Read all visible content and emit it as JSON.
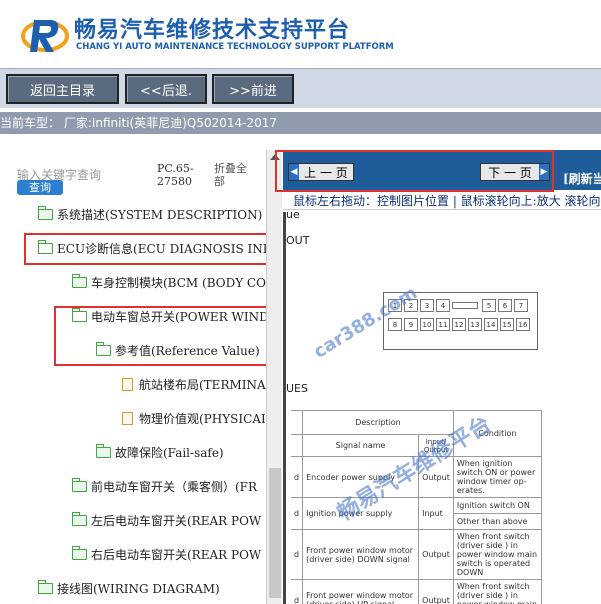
{
  "header": {
    "title_cn": "畅易汽车维修技术支持平台",
    "title_en": "CHANG YI AUTO MAINTENANCE TECHNOLOGY SUPPORT PLATFORM"
  },
  "nav": {
    "home": "返回主目录",
    "back": "<<后退.",
    "forward": ">>前进"
  },
  "current_car": "当前车型：  厂家:Infiniti(英菲尼迪)Q502014-2017",
  "left_panel": {
    "search_placeholder": "输入关键字查询",
    "search_button": "查询",
    "pc_code": "PC.65-27580",
    "collapse_all": "折叠全部",
    "tree": [
      {
        "label": "系统描述(SYSTEM DESCRIPTION)",
        "type": "folder"
      },
      {
        "label": "ECU诊断信息(ECU DIAGNOSIS INFO",
        "type": "folder-open"
      },
      {
        "label": "车身控制模块(BCM (BODY CO",
        "type": "folder"
      },
      {
        "label": "电动车窗总开关(POWER WIND",
        "type": "folder-open"
      },
      {
        "label": "参考值(Reference Value)",
        "type": "folder-open"
      },
      {
        "label": "航站楼布局(TERMINA",
        "type": "doc"
      },
      {
        "label": "物理价值观(PHYSICAI",
        "type": "doc"
      },
      {
        "label": "故障保险(Fail-safe)",
        "type": "folder"
      },
      {
        "label": "前电动车窗开关（乘客侧）(FR",
        "type": "folder"
      },
      {
        "label": "左后电动车窗开关(REAR POW",
        "type": "folder"
      },
      {
        "label": "右后电动车窗开关(REAR POW",
        "type": "folder"
      },
      {
        "label": "接线图(WIRING DIAGRAM)",
        "type": "folder"
      }
    ]
  },
  "viewer": {
    "prev_page": "上 一 页",
    "next_page": "下 一 页",
    "refresh": "[刷新当",
    "hint": "鼠标左右拖动：控制图片位置 | 鼠标滚轮向上:放大   滚轮向",
    "doc_fragments": {
      "ue": "ue",
      "out": "OUT",
      "ues": "UES"
    },
    "connector_pins_top": [
      "1",
      "2",
      "3",
      "4",
      "",
      "5",
      "6",
      "7"
    ],
    "connector_pins_bottom": [
      "8",
      "9",
      "10",
      "11",
      "12",
      "13",
      "14",
      "15",
      "16"
    ],
    "table": {
      "header_description": "Description",
      "header_signal": "Signal name",
      "header_io": "Input/ Output",
      "header_condition": "Condition",
      "rows": [
        {
          "prefix": "d",
          "signal": "Encoder power supply",
          "io": "Output",
          "condition": "When ignition switch ON or power window timer op-erates."
        },
        {
          "prefix": "d",
          "signal": "Ignition power supply",
          "io": "Input",
          "condition": "Ignition switch ON"
        },
        {
          "prefix": "",
          "signal": "",
          "io": "",
          "condition": "Other than above"
        },
        {
          "prefix": "d",
          "signal": "Front power window motor (driver side) DOWN signal",
          "io": "Output",
          "condition": "When front switch (driver side ) in power window main switch is operated DOWN"
        },
        {
          "prefix": "d",
          "signal": "Front power window motor (driver side) UP signal",
          "io": "Output",
          "condition": "When front switch (driver side ) in power window main switch is operated"
        }
      ]
    }
  },
  "watermark": {
    "line1": "car388.com",
    "line2": "畅易汽车维修平台"
  },
  "colors": {
    "brand_blue": "#1d5fae",
    "viewer_bar": "#1e5c9a",
    "highlight_red": "#e03030",
    "folder_green": "#3fa83f",
    "doc_orange": "#e0962b"
  }
}
